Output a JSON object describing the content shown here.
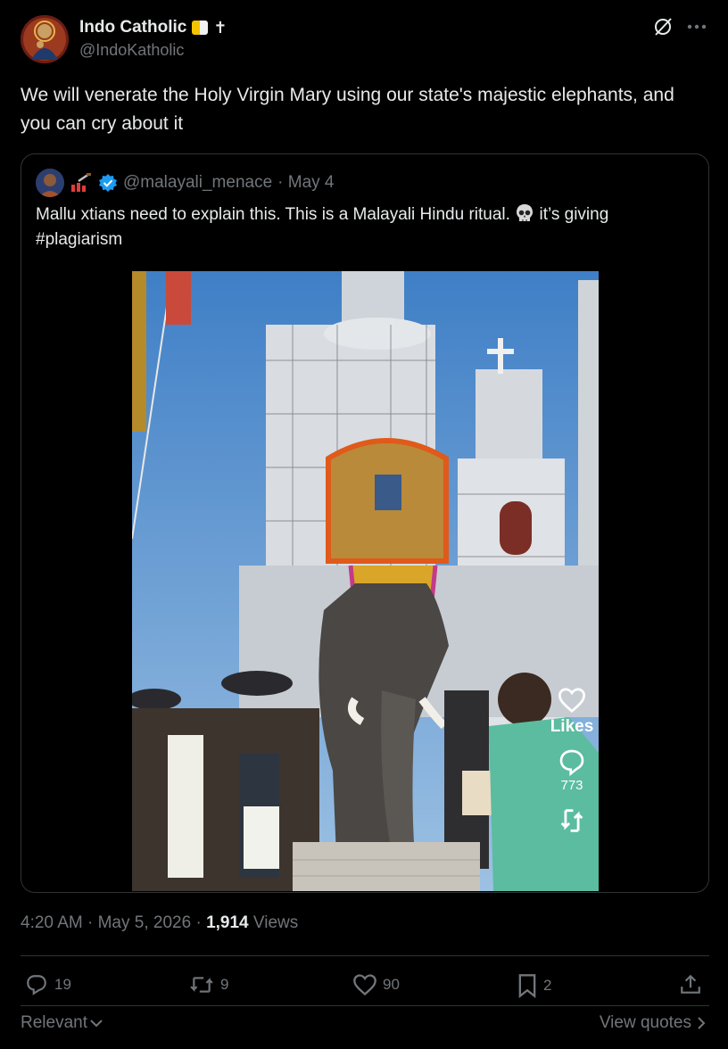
{
  "tweet": {
    "author_name": "Indo Catholic",
    "author_badge": "✝",
    "handle": "@IndoKatholic",
    "text": "We will venerate the Holy Virgin Mary using our state's majestic elephants, and you can cry about it",
    "timestamp": "4:20 AM · May 5, 2026",
    "separator": " · ",
    "views_count": "1,914",
    "views_label": " Views"
  },
  "quote": {
    "handle": "@malayali_menace",
    "date": "· May 4",
    "text_before": "Mallu xtians need to explain this. This is a Malayali Hindu ritual. ",
    "text_after": " it’s giving",
    "hashtag": "#plagiarism",
    "overlay": {
      "likes_label": "Likes",
      "count": "773"
    }
  },
  "actions": {
    "replies": "19",
    "reposts": "9",
    "likes": "90",
    "bookmarks": "2"
  },
  "footer": {
    "sort_label": "Relevant",
    "view_quotes": "View quotes"
  },
  "colors": {
    "background": "#000000",
    "text": "#e7e9ea",
    "muted": "#71767b",
    "border": "#2f3336",
    "verified": "#1d9bf0"
  }
}
